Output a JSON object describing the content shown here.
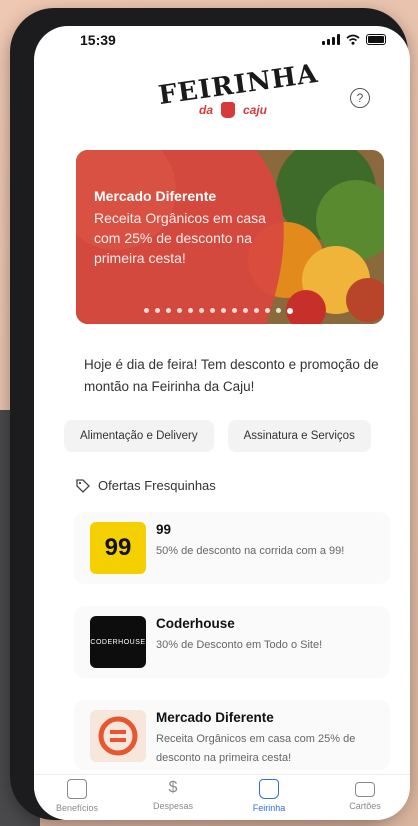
{
  "status": {
    "time": "15:39"
  },
  "brand": {
    "name": "FEIRINHA",
    "sub_left": "da",
    "sub_right": "caju"
  },
  "help": {
    "glyph": "?"
  },
  "banner": {
    "title": "Mercado Diferente",
    "description": "Receita Orgânicos em casa com 25% de desconto na primeira cesta!",
    "dots": 14,
    "active_dot": 13
  },
  "intro": "Hoje é dia de feira! Tem desconto e promoção de montão na Feirinha da Caju!",
  "chips": [
    "Alimentação e Delivery",
    "Assinatura e Serviços"
  ],
  "section": {
    "title": "Ofertas Fresquinhas"
  },
  "offers": [
    {
      "name": "99",
      "description": "50% de desconto na corrida com a 99!",
      "logo": "99"
    },
    {
      "name": "Coderhouse",
      "description": "30% de Desconto em Todo o Site!",
      "logo": "CODERHOUSE"
    },
    {
      "name": "Mercado Diferente",
      "description": "Receita Orgânicos em casa com 25% de desconto na primeira cesta!",
      "logo": "mercado-diferente-logo"
    }
  ],
  "tabs": [
    {
      "label": "Benefícios",
      "icon": "home-icon"
    },
    {
      "label": "Despesas",
      "icon": "dollar-icon"
    },
    {
      "label": "Feirinha",
      "icon": "bag-icon",
      "active": true
    },
    {
      "label": "Cartões",
      "icon": "card-icon"
    }
  ],
  "colors": {
    "accent": "#2f6ee5",
    "brand_red": "#d63a3a",
    "yellow_99": "#f5d000"
  }
}
